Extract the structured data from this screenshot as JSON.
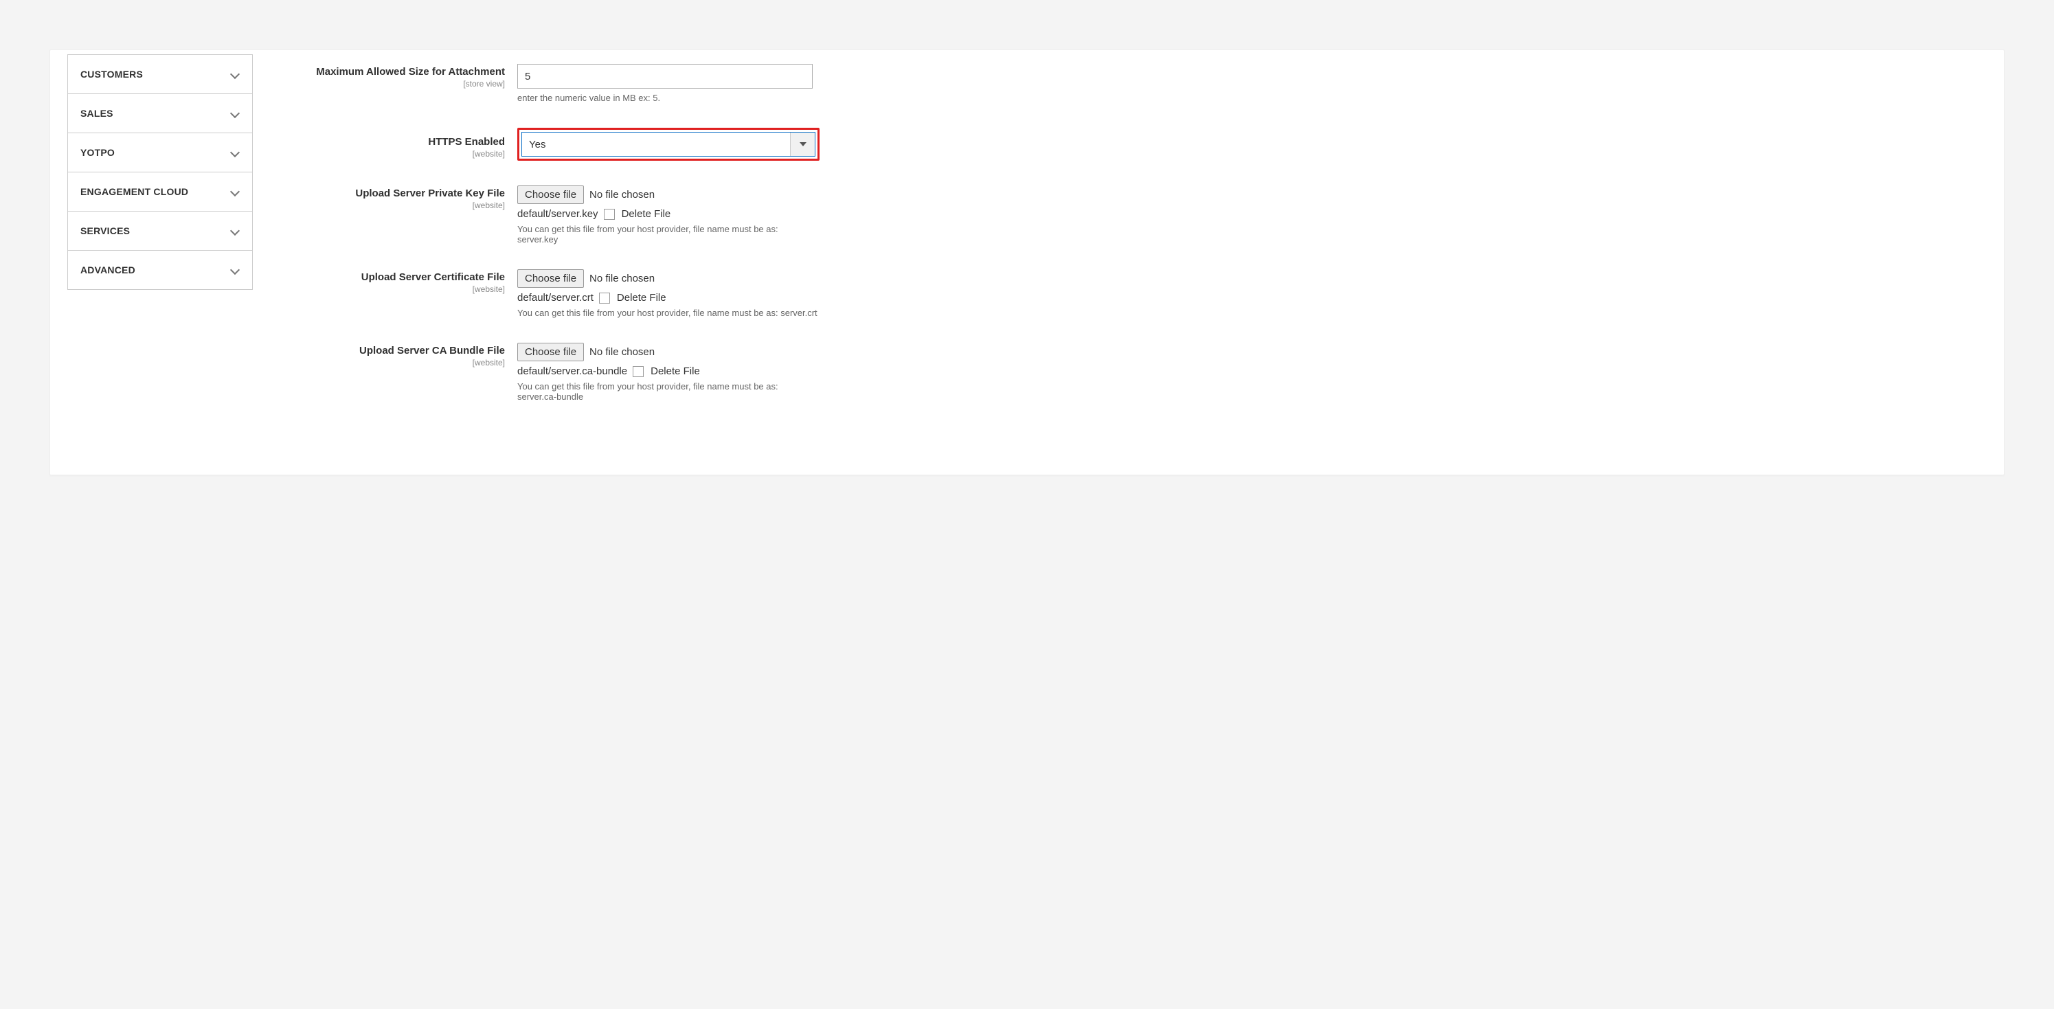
{
  "sidebar": {
    "items": [
      {
        "label": "CUSTOMERS"
      },
      {
        "label": "SALES"
      },
      {
        "label": "YOTPO"
      },
      {
        "label": "ENGAGEMENT CLOUD"
      },
      {
        "label": "SERVICES"
      },
      {
        "label": "ADVANCED"
      }
    ]
  },
  "fields": {
    "max_attach": {
      "label": "Maximum Allowed Size for Attachment",
      "scope": "[store view]",
      "value": "5",
      "helper": "enter the numeric value in MB ex: 5."
    },
    "https": {
      "label": "HTTPS Enabled",
      "scope": "[website]",
      "value": "Yes"
    },
    "pkey": {
      "label": "Upload Server Private Key File",
      "scope": "[website]",
      "choose": "Choose file",
      "nofile": "No file chosen",
      "fname": "default/server.key",
      "delete": "Delete File",
      "helper": "You can get this file from your host provider, file name must be as: server.key"
    },
    "cert": {
      "label": "Upload Server Certificate File",
      "scope": "[website]",
      "choose": "Choose file",
      "nofile": "No file chosen",
      "fname": "default/server.crt",
      "delete": "Delete File",
      "helper": "You can get this file from your host provider, file name must be as: server.crt"
    },
    "cab": {
      "label": "Upload Server CA Bundle File",
      "scope": "[website]",
      "choose": "Choose file",
      "nofile": "No file chosen",
      "fname": "default/server.ca-bundle",
      "delete": "Delete File",
      "helper": "You can get this file from your host provider, file name must be as: server.ca-bundle"
    }
  }
}
